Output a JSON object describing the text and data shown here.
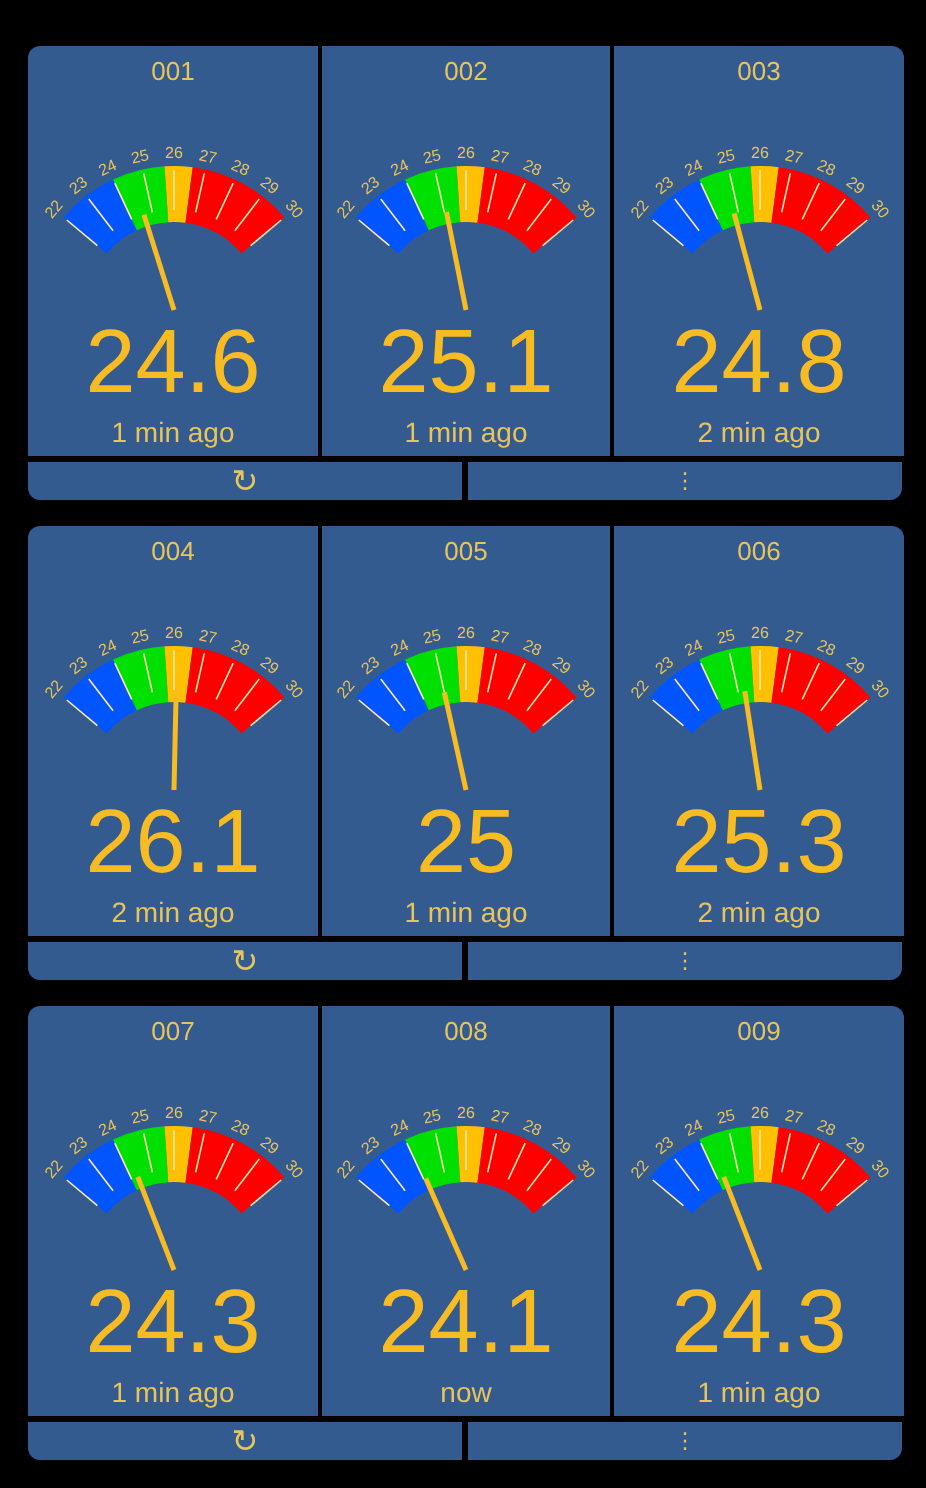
{
  "groups": [
    {
      "cards": [
        {
          "id": "001",
          "scale": [
            "22",
            "23",
            "24",
            "25",
            "26",
            "27",
            "28",
            "29",
            "30"
          ],
          "value": "24.6",
          "updated": "1 min ago"
        },
        {
          "id": "002",
          "scale": [
            "22",
            "23",
            "24",
            "25",
            "26",
            "27",
            "28",
            "29",
            "30"
          ],
          "value": "25.1",
          "updated": "1 min ago"
        },
        {
          "id": "003",
          "scale": [
            "22",
            "23",
            "24",
            "25",
            "26",
            "27",
            "28",
            "29",
            "30"
          ],
          "value": "24.8",
          "updated": "2 min ago"
        }
      ],
      "actions": [
        {
          "kind": "refresh",
          "label": "↻"
        },
        {
          "kind": "menu",
          "label": "⋮"
        }
      ]
    },
    {
      "cards": [
        {
          "id": "004",
          "scale": [
            "22",
            "23",
            "24",
            "25",
            "26",
            "27",
            "28",
            "29",
            "30"
          ],
          "value": "26.1",
          "updated": "2 min ago"
        },
        {
          "id": "005",
          "scale": [
            "22",
            "23",
            "24",
            "25",
            "26",
            "27",
            "28",
            "29",
            "30"
          ],
          "value": "25",
          "updated": "1 min ago"
        },
        {
          "id": "006",
          "scale": [
            "22",
            "23",
            "24",
            "25",
            "26",
            "27",
            "28",
            "29",
            "30"
          ],
          "value": "25.3",
          "updated": "2 min ago"
        }
      ],
      "actions": [
        {
          "kind": "refresh",
          "label": "↻"
        },
        {
          "kind": "menu",
          "label": "⋮"
        }
      ]
    },
    {
      "cards": [
        {
          "id": "007",
          "scale": [
            "22",
            "23",
            "24",
            "25",
            "26",
            "27",
            "28",
            "29",
            "30"
          ],
          "value": "24.3",
          "updated": "1 min ago"
        },
        {
          "id": "008",
          "scale": [
            "22",
            "23",
            "24",
            "25",
            "26",
            "27",
            "28",
            "29",
            "30"
          ],
          "value": "24.1",
          "updated": "now"
        },
        {
          "id": "009",
          "scale": [
            "22",
            "23",
            "24",
            "25",
            "26",
            "27",
            "28",
            "29",
            "30"
          ],
          "value": "24.3",
          "updated": "1 min ago"
        }
      ],
      "actions": [
        {
          "kind": "refresh",
          "label": "↻"
        },
        {
          "kind": "menu",
          "label": "⋮"
        }
      ]
    }
  ]
}
